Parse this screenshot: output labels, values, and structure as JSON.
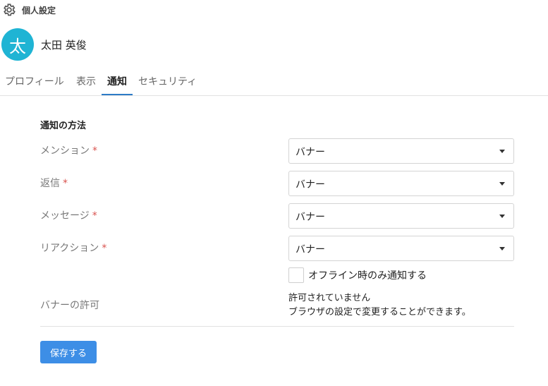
{
  "header": {
    "title": "個人設定",
    "icon": "gear-icon"
  },
  "profile": {
    "avatar_initial": "太",
    "avatar_color": "#1fb4d4",
    "name": "太田 英俊"
  },
  "tabs": [
    {
      "label": "プロフィール",
      "active": false
    },
    {
      "label": "表示",
      "active": false
    },
    {
      "label": "通知",
      "active": true
    },
    {
      "label": "セキュリティ",
      "active": false
    }
  ],
  "notification": {
    "section_title": "通知の方法",
    "required_mark": "*",
    "rows": [
      {
        "label": "メンション",
        "value": "バナー"
      },
      {
        "label": "返信",
        "value": "バナー"
      },
      {
        "label": "メッセージ",
        "value": "バナー"
      },
      {
        "label": "リアクション",
        "value": "バナー"
      }
    ],
    "offline_only": {
      "label": "オフライン時のみ通知する",
      "checked": false
    },
    "banner_permission": {
      "label": "バナーの許可",
      "status_line1": "許可されていません",
      "status_line2": "ブラウザの設定で変更することができます。"
    }
  },
  "save_button": {
    "label": "保存する",
    "color": "#3d8ee6"
  },
  "colors": {
    "accent": "#2d7bc7",
    "required": "#d9534f"
  }
}
